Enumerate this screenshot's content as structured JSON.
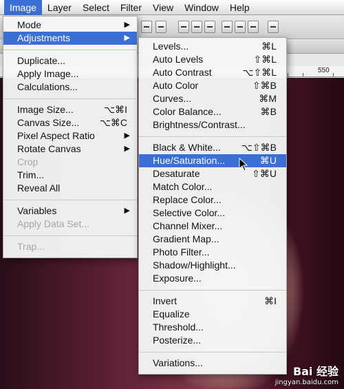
{
  "menubar": {
    "items": [
      "Image",
      "Layer",
      "Select",
      "Filter",
      "View",
      "Window",
      "Help"
    ],
    "active_index": 0
  },
  "ruler": {
    "marks": [
      "550"
    ]
  },
  "image_menu": {
    "groups": [
      [
        {
          "label": "Mode",
          "submenu": true
        },
        {
          "label": "Adjustments",
          "submenu": true,
          "highlighted": true
        }
      ],
      [
        {
          "label": "Duplicate..."
        },
        {
          "label": "Apply Image..."
        },
        {
          "label": "Calculations..."
        }
      ],
      [
        {
          "label": "Image Size...",
          "shortcut": "⌥⌘I"
        },
        {
          "label": "Canvas Size...",
          "shortcut": "⌥⌘C"
        },
        {
          "label": "Pixel Aspect Ratio",
          "submenu": true
        },
        {
          "label": "Rotate Canvas",
          "submenu": true
        },
        {
          "label": "Crop",
          "disabled": true
        },
        {
          "label": "Trim..."
        },
        {
          "label": "Reveal All"
        }
      ],
      [
        {
          "label": "Variables",
          "submenu": true
        },
        {
          "label": "Apply Data Set...",
          "disabled": true
        }
      ],
      [
        {
          "label": "Trap...",
          "disabled": true
        }
      ]
    ]
  },
  "adjustments_menu": {
    "groups": [
      [
        {
          "label": "Levels...",
          "shortcut": "⌘L"
        },
        {
          "label": "Auto Levels",
          "shortcut": "⇧⌘L"
        },
        {
          "label": "Auto Contrast",
          "shortcut": "⌥⇧⌘L"
        },
        {
          "label": "Auto Color",
          "shortcut": "⇧⌘B"
        },
        {
          "label": "Curves...",
          "shortcut": "⌘M"
        },
        {
          "label": "Color Balance...",
          "shortcut": "⌘B"
        },
        {
          "label": "Brightness/Contrast..."
        }
      ],
      [
        {
          "label": "Black & White...",
          "shortcut": "⌥⇧⌘B"
        },
        {
          "label": "Hue/Saturation...",
          "shortcut": "⌘U",
          "highlighted": true
        },
        {
          "label": "Desaturate",
          "shortcut": "⇧⌘U"
        },
        {
          "label": "Match Color..."
        },
        {
          "label": "Replace Color..."
        },
        {
          "label": "Selective Color..."
        },
        {
          "label": "Channel Mixer..."
        },
        {
          "label": "Gradient Map..."
        },
        {
          "label": "Photo Filter..."
        },
        {
          "label": "Shadow/Highlight..."
        },
        {
          "label": "Exposure..."
        }
      ],
      [
        {
          "label": "Invert",
          "shortcut": "⌘I"
        },
        {
          "label": "Equalize"
        },
        {
          "label": "Threshold..."
        },
        {
          "label": "Posterize..."
        }
      ],
      [
        {
          "label": "Variations..."
        }
      ]
    ]
  },
  "watermark": {
    "main": "Bai 经验",
    "sub": "jingyan.baidu.com"
  },
  "colors": {
    "highlight": "#3b6fd4",
    "disabled": "#a6a6a6"
  },
  "icons": {
    "submenu": "submenu-arrow-icon",
    "pointer": "mouse-pointer-icon"
  }
}
